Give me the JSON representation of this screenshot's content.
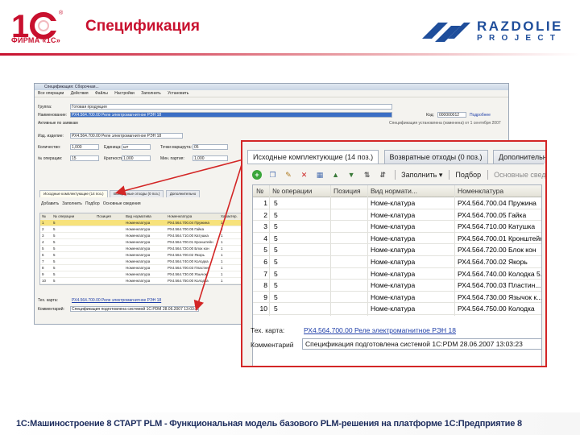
{
  "slide": {
    "title": "Спецификация",
    "logo_1c_caption": "ФИРМА «1С»",
    "logo_rz_name": "RAZDOLIE",
    "logo_rz_sub": "PROJECT",
    "footer": "1С:Машиностроение 8 СТАРТ PLM - Функциональная модель базового PLM-решения на платформе 1С:Предприятие 8"
  },
  "small_window": {
    "title": "Спецификация: Сборочная...",
    "toolbar": [
      "Все операции",
      "Действия",
      "Файлы",
      "Настройки",
      "Заполнить",
      "Установить"
    ],
    "fields": {
      "group_label": "Группа:",
      "group_value": "Готовая продукция",
      "name_label": "Наименование:",
      "name_value": "РХ4.564.700.00 Реле электромагнитное РЭН 18",
      "code_label": "Код:",
      "code_value": "000000012",
      "code_link": "Подробнее",
      "check_label": "Активные по заявкам",
      "note": "Спецификация установлена (изменена) от 1 сентября 2007",
      "product_label": "Изд. изделие:",
      "product_value": "РХ4.564.700.00 Реле электромагнитное РЭН 18",
      "qty_label": "Количество:",
      "qty_value": "1,000",
      "unit_label": "Единица:",
      "unit_value": "шт",
      "route_label": "Точки маршрута:",
      "route_value": "05",
      "ops_label": "№ операции:",
      "ops_value": "15",
      "mult_label": "Кратность:",
      "mult_value": "1,000",
      "min_label": "Мин. партия:",
      "min_value": "1,000"
    },
    "tabs": [
      "Исходные комплектующие (14 поз.)",
      "Возвратные отходы (0 поз.)",
      "Дополнительно"
    ],
    "toolbar2": [
      "Добавить",
      "Заполнить",
      "Подбор",
      "Основные сведения"
    ],
    "grid_headers": [
      "№",
      "№ операции",
      "Позиция",
      "Вид норматива",
      "Номенклатура",
      "Характер."
    ],
    "grid_rows": [
      [
        "1",
        "5",
        "",
        "Номенклатура",
        "РХ4.564.700.04 Пружина",
        "1"
      ],
      [
        "2",
        "5",
        "",
        "Номенклатура",
        "РХ4.564.700.05 Гайка",
        "2"
      ],
      [
        "3",
        "5",
        "",
        "Номенклатура",
        "РХ4.564.710.00 Катушка",
        "1"
      ],
      [
        "4",
        "5",
        "",
        "Номенклатура",
        "РХ4.564.700.01 Кронштейн",
        "1"
      ],
      [
        "5",
        "5",
        "",
        "Номенклатура",
        "РХ4.564.720.00 Блок кон",
        "1"
      ],
      [
        "6",
        "5",
        "",
        "Номенклатура",
        "РХ4.564.700.02 Якорь",
        "1"
      ],
      [
        "7",
        "5",
        "",
        "Номенклатура",
        "РХ4.564.740.00 Колодка",
        "1"
      ],
      [
        "8",
        "5",
        "",
        "Номенклатура",
        "РХ4.564.700.03 Пластин",
        "1"
      ],
      [
        "9",
        "5",
        "",
        "Номенклатура",
        "РХ4.564.730.00 Язычок",
        "1"
      ],
      [
        "10",
        "5",
        "",
        "Номенклатура",
        "РХ4.564.750.00 Колодка",
        "1"
      ]
    ],
    "footer_card_label": "Тех. карта:",
    "footer_card_value": "РХ4.564.700.00 Реле электромагнитное РЭН 18",
    "footer_comment_label": "Комментарий:",
    "footer_comment_value": "Спецификация подготовлена системой 1С:PDM 28.06.2007 13:03:23"
  },
  "zoom_panel": {
    "tabs": [
      "Исходные комплектующие (14 поз.)",
      "Возвратные отходы (0 поз.)",
      "Дополнительно"
    ],
    "toolbar": {
      "fill_label": "Заполнить",
      "pick_label": "Подбор",
      "details_label": "Основные сведе"
    },
    "columns": [
      "№",
      "№ операции",
      "Позиция",
      "Вид нормати...",
      "Номенклатура"
    ],
    "rows": [
      {
        "n": "1",
        "op": "5",
        "pos": "",
        "kind": "Номе-клатура",
        "item": "РХ4.564.700.04 Пружина"
      },
      {
        "n": "2",
        "op": "5",
        "pos": "",
        "kind": "Номе-клатура",
        "item": "РХ4.564.700.05 Гайка"
      },
      {
        "n": "3",
        "op": "5",
        "pos": "",
        "kind": "Номе-клатура",
        "item": "РХ4.564.710.00 Катушка"
      },
      {
        "n": "4",
        "op": "5",
        "pos": "",
        "kind": "Номе-клатура",
        "item": "РХ4.564.700.01 Кронштейн"
      },
      {
        "n": "5",
        "op": "5",
        "pos": "",
        "kind": "Номе-клатура",
        "item": "РХ4.564.720.00 Блок кон"
      },
      {
        "n": "6",
        "op": "5",
        "pos": "",
        "kind": "Номе-клатура",
        "item": "РХ4.564.700.02 Якорь"
      },
      {
        "n": "7",
        "op": "5",
        "pos": "",
        "kind": "Номе-клатура",
        "item": "РХ4.564.740.00 Колодка 5..."
      },
      {
        "n": "8",
        "op": "5",
        "pos": "",
        "kind": "Номе-клатура",
        "item": "РХ4.564.700.03 Пластин..."
      },
      {
        "n": "9",
        "op": "5",
        "pos": "",
        "kind": "Номе-клатура",
        "item": "РХ4.564.730.00 Язычок к..."
      },
      {
        "n": "10",
        "op": "5",
        "pos": "",
        "kind": "Номе-клатура",
        "item": "РХ4.564.750.00 Колодка"
      }
    ],
    "card_label": "Тех. карта:",
    "card_value": "РХ4.564.700.00 Реле электромагнитное РЭН 18",
    "comment_label": "Комментарий",
    "comment_value": "Спецификация подготовлена системой 1С:PDM 28.06.2007 13:03:23"
  },
  "colors": {
    "brand_red": "#c8102e",
    "brand_blue": "#1f4e9b",
    "callout_red": "#d32626",
    "selected_row": "#f6e38b"
  }
}
